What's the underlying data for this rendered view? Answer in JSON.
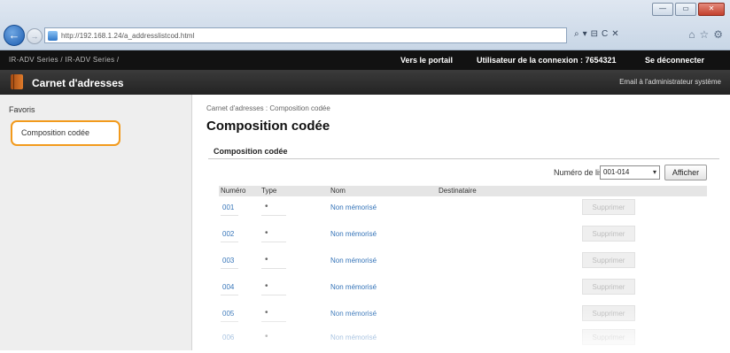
{
  "browser": {
    "url": "http://192.168.1.24/a_addresslistcod.html",
    "back_glyph": "←",
    "fwd_glyph": "→",
    "window_controls": [
      "—",
      "▭",
      "✕"
    ],
    "address_tools": [
      "⌕",
      "▾",
      "⊟",
      "C",
      "✕"
    ],
    "right_icons": [
      "⌂",
      "☆",
      "⚙"
    ]
  },
  "header": {
    "model_text": "IR-ADV Series / IR-ADV Series /",
    "portal_link": "Vers le portail",
    "user_label": "Utilisateur de la connexion :  7654321",
    "logout_link": "Se déconnecter",
    "app_title": "Carnet d'adresses",
    "admin_email": "Email à l'administrateur système"
  },
  "sidebar": {
    "items": [
      {
        "label": "Favoris"
      },
      {
        "label": "Composition codée"
      }
    ]
  },
  "main": {
    "breadcrumb": "Carnet d'adresses : Composition codée",
    "page_title": "Composition codée",
    "section_title": "Composition codée",
    "list_label": "Numéro de liste :",
    "list_value": "001-014",
    "list_arrow": "▾",
    "show_button": "Afficher",
    "columns": {
      "number": "Numéro",
      "type": "Type",
      "name": "Nom",
      "destination": "Destinataire"
    },
    "rows": [
      {
        "number": "001",
        "type": "•",
        "name": "Non mémorisé",
        "delete": "Supprimer"
      },
      {
        "number": "002",
        "type": "•",
        "name": "Non mémorisé",
        "delete": "Supprimer"
      },
      {
        "number": "003",
        "type": "•",
        "name": "Non mémorisé",
        "delete": "Supprimer"
      },
      {
        "number": "004",
        "type": "•",
        "name": "Non mémorisé",
        "delete": "Supprimer"
      },
      {
        "number": "005",
        "type": "•",
        "name": "Non mémorisé",
        "delete": "Supprimer"
      },
      {
        "number": "006",
        "type": "•",
        "name": "Non mémorisé",
        "delete": "Supprimer"
      }
    ]
  },
  "colors": {
    "accent_orange": "#f29a1c",
    "link_blue": "#3574b8",
    "header_black": "#121212"
  }
}
